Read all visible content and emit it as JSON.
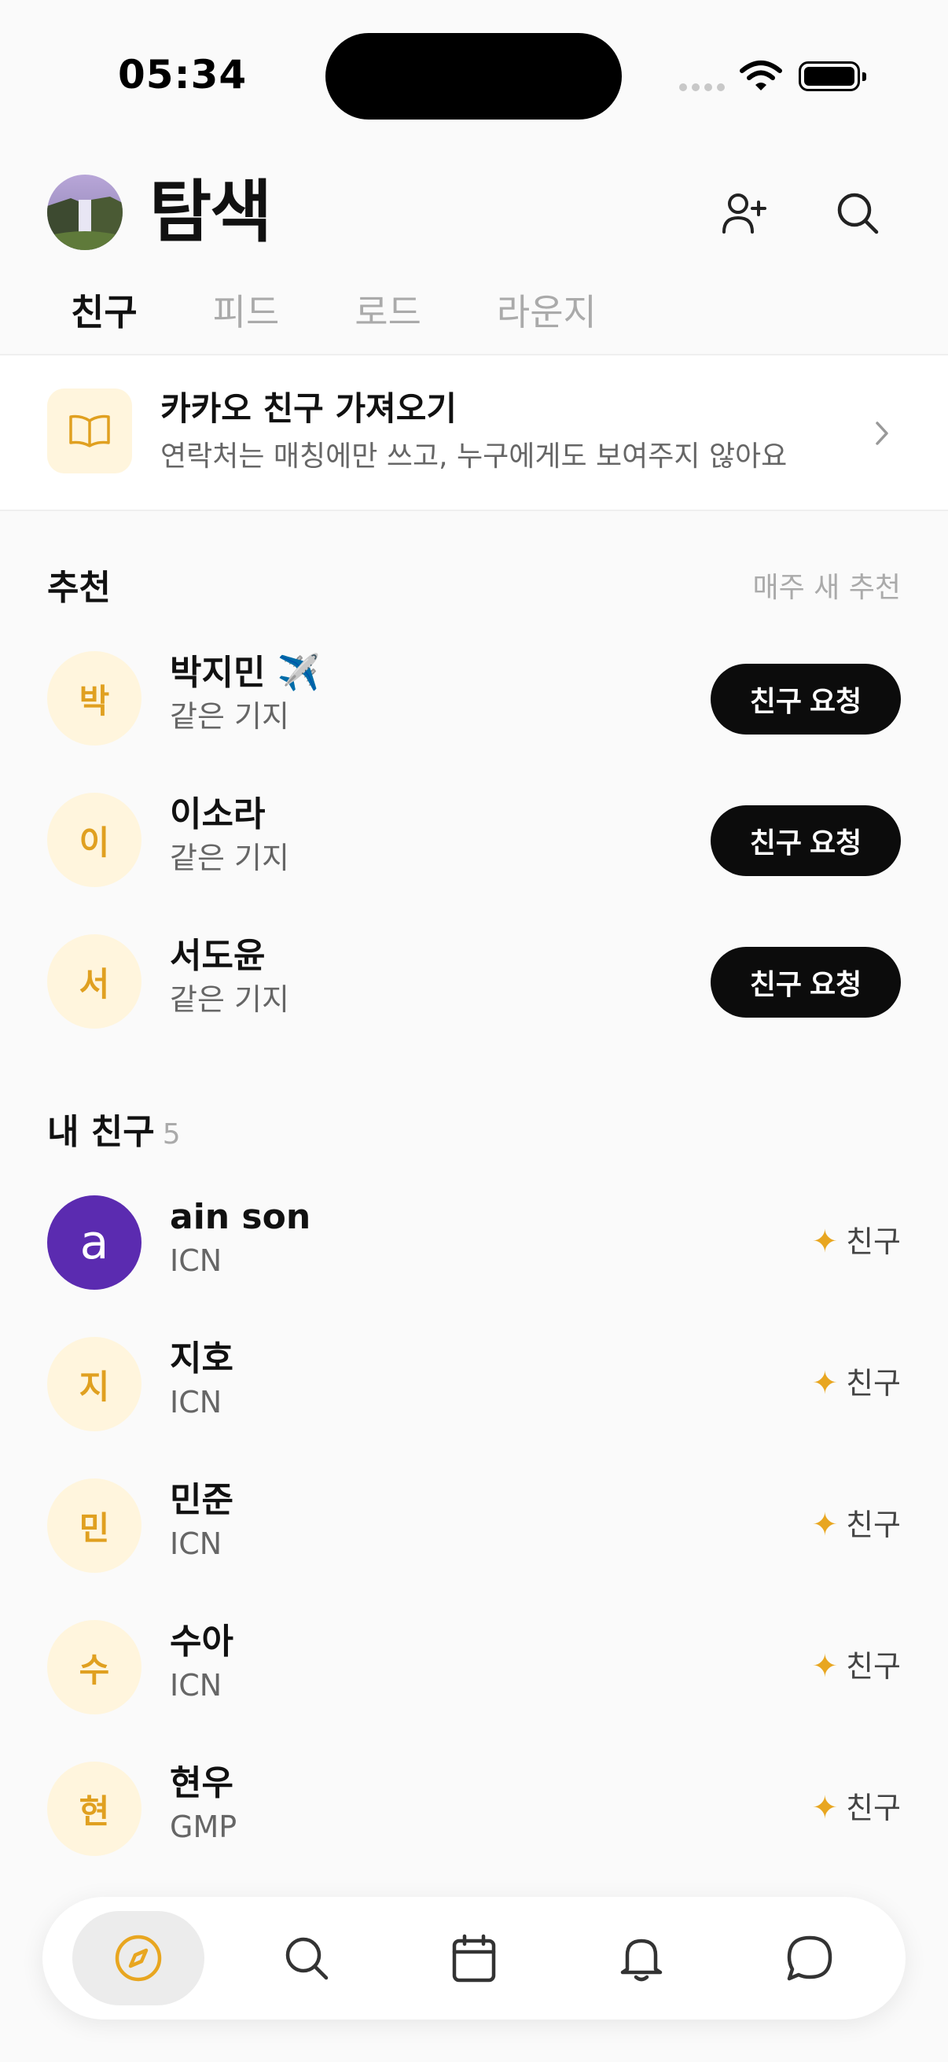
{
  "status_bar": {
    "time": "05:34"
  },
  "header": {
    "title": "탐색"
  },
  "tabs": [
    {
      "label": "친구",
      "active": true
    },
    {
      "label": "피드",
      "active": false
    },
    {
      "label": "로드",
      "active": false
    },
    {
      "label": "라운지",
      "active": false
    }
  ],
  "banner": {
    "icon": "book-icon",
    "title": "카카오 친구 가져오기",
    "subtitle": "연락처는 매칭에만 쓰고, 누구에게도 보여주지 않아요"
  },
  "recommend": {
    "title": "추천",
    "note": "매주 새 추천",
    "button_label": "친구 요청",
    "items": [
      {
        "initial": "박",
        "name": "박지민 ✈️",
        "sub": "같은 기지"
      },
      {
        "initial": "이",
        "name": "이소라",
        "sub": "같은 기지"
      },
      {
        "initial": "서",
        "name": "서도윤",
        "sub": "같은 기지"
      }
    ]
  },
  "friends": {
    "title": "내 친구",
    "count": "5",
    "tag_label": "친구",
    "items": [
      {
        "initial": "a",
        "name": "ain son",
        "sub": "ICN"
      },
      {
        "initial": "지",
        "name": "지호",
        "sub": "ICN"
      },
      {
        "initial": "민",
        "name": "민준",
        "sub": "ICN"
      },
      {
        "initial": "수",
        "name": "수아",
        "sub": "ICN"
      },
      {
        "initial": "현",
        "name": "현우",
        "sub": "GMP"
      }
    ]
  },
  "bottom_nav": [
    {
      "icon": "compass-icon",
      "active": true
    },
    {
      "icon": "search-icon",
      "active": false
    },
    {
      "icon": "calendar-icon",
      "active": false
    },
    {
      "icon": "bell-icon",
      "active": false
    },
    {
      "icon": "chat-bubble-icon",
      "active": false
    }
  ],
  "colors": {
    "accent": "#e8a620",
    "avatar_bg": "#fff5dd",
    "purple": "#5b2bb0",
    "button_bg": "#0c0c0c"
  }
}
